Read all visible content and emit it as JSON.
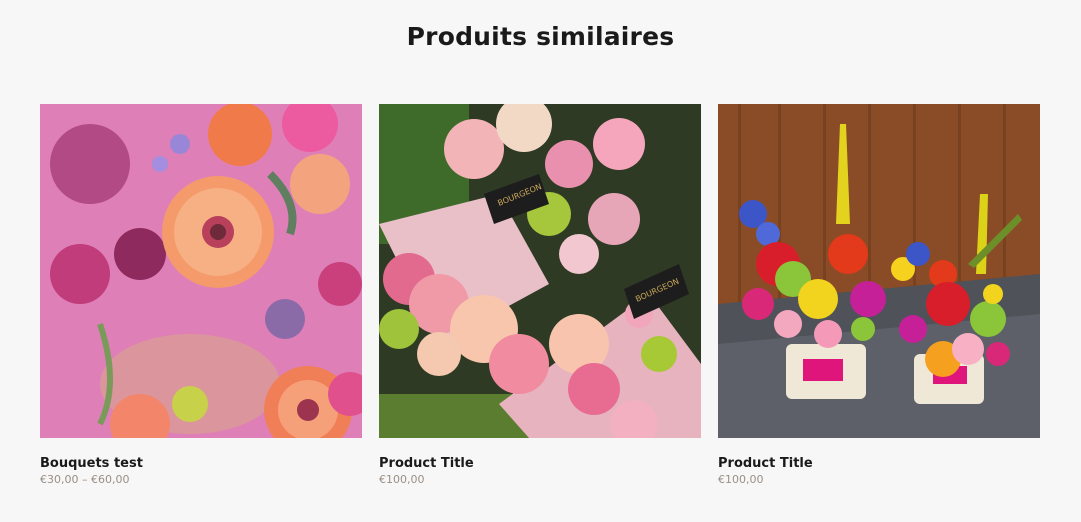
{
  "section": {
    "title": "Produits similaires"
  },
  "products": [
    {
      "title": "Bouquets test",
      "price": "€30,00 – €60,00"
    },
    {
      "title": "Product Title",
      "price": "€100,00"
    },
    {
      "title": "Product Title",
      "price": "€100,00"
    }
  ],
  "product_images": [
    {
      "description_icon": "pink-bouquet-image",
      "label": ""
    },
    {
      "description_icon": "peach-roses-boxes-image",
      "label": "BOURGEON"
    },
    {
      "description_icon": "colorful-flower-pots-image",
      "label": ""
    }
  ],
  "colors": {
    "background": "#f7f7f7",
    "title": "#1a1a1a",
    "price": "#9a8f86"
  }
}
